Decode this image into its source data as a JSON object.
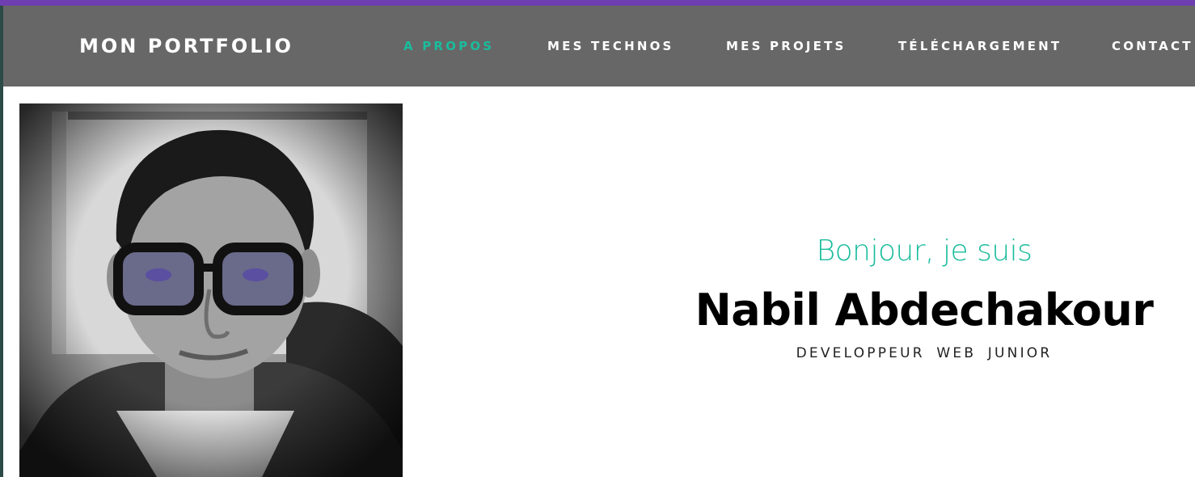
{
  "colors": {
    "accent": "#1abc9c",
    "navbar_bg": "#676767",
    "top_bar": "#6f3eb0",
    "text_dark": "#000000",
    "text_light": "#ffffff"
  },
  "navbar": {
    "brand": "MON PORTFOLIO",
    "items": [
      {
        "label": "A PROPOS",
        "active": true
      },
      {
        "label": "MES TECHNOS",
        "active": false
      },
      {
        "label": "MES PROJETS",
        "active": false
      },
      {
        "label": "TÉLÉCHARGEMENT",
        "active": false
      },
      {
        "label": "CONTACT",
        "active": false
      }
    ]
  },
  "hero": {
    "greeting": "Bonjour, je suis",
    "name": "Nabil Abdechakour",
    "role": "DEVELOPPEUR WEB JUNIOR"
  }
}
